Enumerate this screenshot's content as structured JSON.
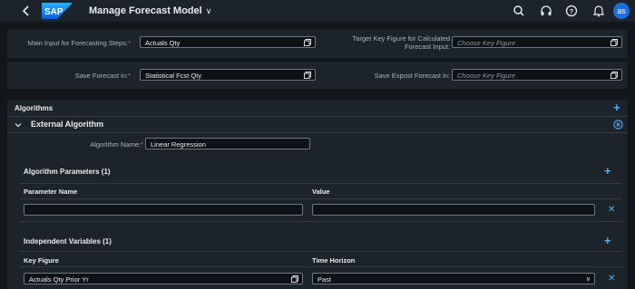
{
  "shell": {
    "title": "Manage Forecast Model",
    "avatar_initials": "as",
    "icons": [
      "back-icon",
      "search-icon",
      "headset-icon",
      "help-icon",
      "notification-icon"
    ]
  },
  "top_form": {
    "main_input_label": "Main Input for Forecasting Steps:",
    "main_input_value": "Actuals Qty",
    "target_kf_label_line1": "Target Key Figure for Calculated",
    "target_kf_label_line2": "Forecast Input:",
    "target_kf_placeholder": "Choose Key Figure",
    "save_forecast_label": "Save Forecast in:",
    "save_forecast_value": "Statistical Fcst Qty",
    "save_expost_label": "Save Expost Forecast in:",
    "save_expost_placeholder": "Choose Key Figure"
  },
  "algorithms": {
    "title": "Algorithms",
    "external": {
      "title": "External Algorithm",
      "algorithm_name_label": "Algorithm Name:",
      "algorithm_name_value": "Linear Regression"
    },
    "parameters": {
      "title": "Algorithm Parameters (1)",
      "col_name": "Parameter Name",
      "col_value": "Value",
      "rows": [
        {
          "name": "",
          "value": ""
        }
      ]
    },
    "independent_variables": {
      "title": "Independent Variables (1)",
      "col_key_figure": "Key Figure",
      "col_time_horizon": "Time Horizon",
      "rows": [
        {
          "key_figure": "Actuals Qty Prior Yr",
          "time_horizon": "Past"
        }
      ]
    }
  },
  "colors": {
    "accent": "#4db1ff",
    "avatar": "#1b6ee0",
    "required": "#ff5d5d",
    "panel": "#1d232a",
    "background": "#12171c"
  }
}
